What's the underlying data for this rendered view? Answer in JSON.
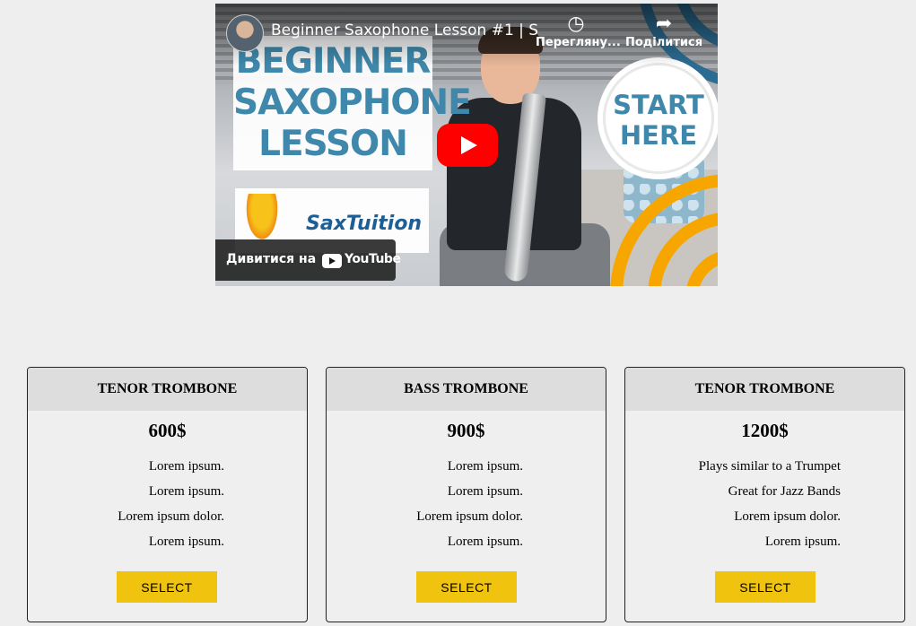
{
  "video": {
    "title": "Beginner Saxophone Lesson #1 | S...",
    "watch_later_label": "Перегляну...",
    "share_label": "Поділитися",
    "watch_on_label": "Дивитися на",
    "youtube_label": "YouTube",
    "thumbnail": {
      "title_lines": [
        "BEGINNER",
        "SAXOPHONE",
        "LESSON"
      ],
      "brand": "SaxTuition",
      "badge_lines": [
        "START",
        "HERE"
      ]
    },
    "colors": {
      "play": "#ff0000",
      "title_blue": "#3f88ab",
      "arc_orange": "#f7a600"
    }
  },
  "cards": [
    {
      "title": "TENOR TROMBONE",
      "price": "600$",
      "features": [
        "Lorem ipsum.",
        "Lorem ipsum.",
        "Lorem ipsum dolor.",
        "Lorem ipsum."
      ],
      "button": "SELECT"
    },
    {
      "title": "BASS TROMBONE",
      "price": "900$",
      "features": [
        "Lorem ipsum.",
        "Lorem ipsum.",
        "Lorem ipsum dolor.",
        "Lorem ipsum."
      ],
      "button": "SELECT"
    },
    {
      "title": "TENOR TROMBONE",
      "price": "1200$",
      "features": [
        "Plays similar to a Trumpet",
        "Great for Jazz Bands",
        "Lorem ipsum dolor.",
        "Lorem ipsum."
      ],
      "button": "SELECT"
    }
  ],
  "colors": {
    "page_bg": "#eeeeee",
    "card_header_bg": "#dddddd",
    "select_button": "#f0c30f"
  },
  "icons": [
    "play-icon",
    "clock-icon",
    "share-icon",
    "youtube-logo-icon"
  ]
}
